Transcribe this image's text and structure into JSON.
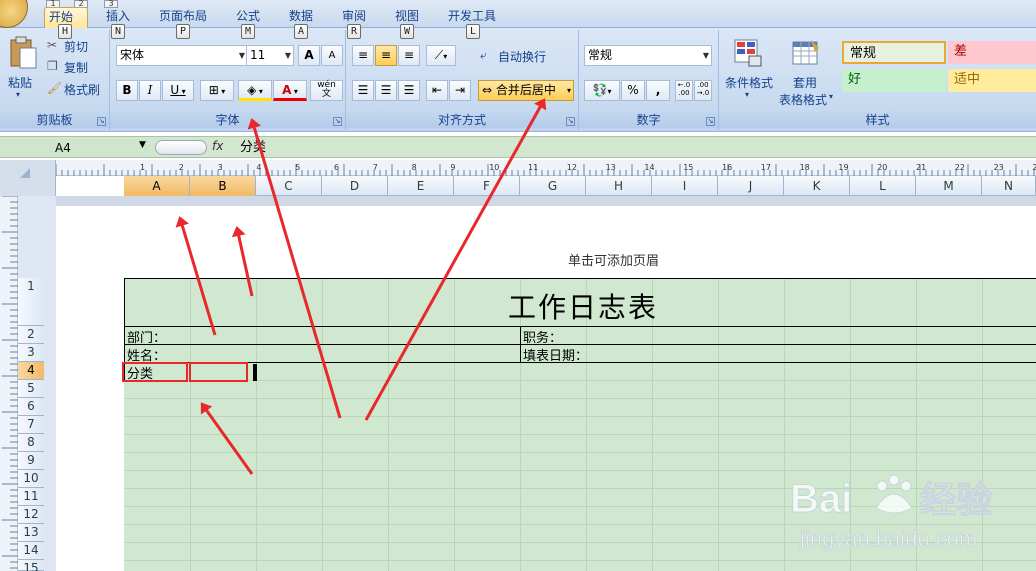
{
  "tabs": {
    "items": [
      {
        "label": "开始",
        "key": "H"
      },
      {
        "label": "插入",
        "key": "N"
      },
      {
        "label": "页面布局",
        "key": "P"
      },
      {
        "label": "公式",
        "key": "M"
      },
      {
        "label": "数据",
        "key": "A"
      },
      {
        "label": "审阅",
        "key": "R"
      },
      {
        "label": "视图",
        "key": "W"
      },
      {
        "label": "开发工具",
        "key": "L"
      }
    ],
    "qat_keys": [
      "1",
      "2",
      "3"
    ]
  },
  "ribbon": {
    "clipboard": {
      "paste": "粘贴",
      "cut": "剪切",
      "copy": "复制",
      "format_painter": "格式刷",
      "label": "剪贴板"
    },
    "font": {
      "name": "宋体",
      "size": "11",
      "bold": "B",
      "italic": "I",
      "underline": "U",
      "grow": "A",
      "shrink": "A",
      "font_color": "A",
      "phonetic_top": "wén",
      "phonetic_bottom": "文",
      "label": "字体"
    },
    "alignment": {
      "wrap": "自动换行",
      "merge": "合并后居中",
      "label": "对齐方式"
    },
    "number": {
      "format": "常规",
      "percent": "%",
      "comma": ",",
      "inc_decimal": "+.0\n.00",
      "dec_decimal": ".00\n+.0",
      "label": "数字"
    },
    "styles": {
      "conditional": "条件格式",
      "table_format_1": "套用",
      "table_format_2": "表格格式",
      "normal": "常规",
      "bad": "差",
      "good": "好",
      "neutral": "适中",
      "label": "样式"
    }
  },
  "formula_bar": {
    "name_box": "A4",
    "fx": "fx",
    "content": "分类"
  },
  "columns": [
    "A",
    "B",
    "C",
    "D",
    "E",
    "F",
    "G",
    "H",
    "I",
    "J",
    "K",
    "L",
    "M",
    "N"
  ],
  "rows": [
    "1",
    "2",
    "3",
    "4",
    "5",
    "6",
    "7",
    "8",
    "9",
    "10",
    "11",
    "12",
    "13",
    "14",
    "15"
  ],
  "ruler": [
    "1",
    "2",
    "3",
    "4",
    "5",
    "6",
    "7",
    "8",
    "9",
    "10",
    "11",
    "12",
    "13",
    "14",
    "15",
    "16",
    "17",
    "18",
    "19",
    "20",
    "21",
    "22",
    "23",
    "24"
  ],
  "sheet": {
    "header_hint": "单击可添加页眉",
    "title": "工作日志表",
    "dept": "部门：",
    "position": "职务：",
    "name": "姓名：",
    "date": "填表日期：",
    "category": "分类"
  },
  "watermark": {
    "brand": "Bai",
    "brand2": "经验",
    "url": "jingyan.baidu.com"
  },
  "colors": {
    "accent_red": "#e8282b",
    "sheet_green": "#cfe8cf",
    "ribbon_blue": "#c8daf0",
    "selected_header": "#f1b964"
  }
}
